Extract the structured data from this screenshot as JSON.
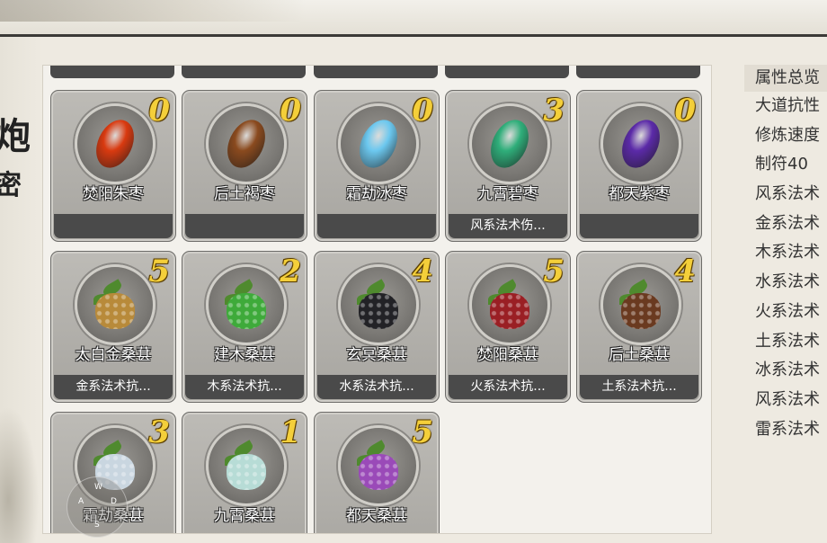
{
  "attributes": {
    "title": "属性总览",
    "rows": [
      "大道抗性",
      "修炼速度",
      "制符40",
      "风系法术",
      "金系法术",
      "木系法术",
      "水系法术",
      "火系法术",
      "土系法术",
      "冰系法术",
      "风系法术",
      "雷系法术"
    ]
  },
  "items": [
    {
      "name": "焚阳朱枣",
      "count": "0",
      "desc": "",
      "kind": "date",
      "color": "#d93a10"
    },
    {
      "name": "后土褐枣",
      "count": "0",
      "desc": "",
      "kind": "date",
      "color": "#8a4a1e"
    },
    {
      "name": "霜劫冰枣",
      "count": "0",
      "desc": "",
      "kind": "date",
      "color": "#6cc8ef"
    },
    {
      "name": "九霄碧枣",
      "count": "3",
      "desc": "风系法术伤...",
      "kind": "date",
      "color": "#2fae7a"
    },
    {
      "name": "都天紫枣",
      "count": "0",
      "desc": "",
      "kind": "date",
      "color": "#5b2aa8"
    },
    {
      "name": "太白金桑葚",
      "count": "5",
      "desc": "金系法术抗...",
      "kind": "berry",
      "color": "#b88a3a"
    },
    {
      "name": "建木桑葚",
      "count": "2",
      "desc": "木系法术抗...",
      "kind": "berry",
      "color": "#3eaa3a"
    },
    {
      "name": "玄冥桑葚",
      "count": "4",
      "desc": "水系法术抗...",
      "kind": "berry",
      "color": "#222226"
    },
    {
      "name": "焚阳桑葚",
      "count": "5",
      "desc": "火系法术抗...",
      "kind": "berry",
      "color": "#9a1f24"
    },
    {
      "name": "后土桑葚",
      "count": "4",
      "desc": "土系法术抗...",
      "kind": "berry",
      "color": "#6a3a20"
    },
    {
      "name": "霜劫桑葚",
      "count": "3",
      "desc": "",
      "kind": "berry",
      "color": "#c9d6e0"
    },
    {
      "name": "九霄桑葚",
      "count": "1",
      "desc": "",
      "kind": "berry",
      "color": "#b7dcd6"
    },
    {
      "name": "都天桑葚",
      "count": "5",
      "desc": "",
      "kind": "berry",
      "color": "#9a4ab8"
    }
  ],
  "side_glyphs": [
    "炮",
    "密"
  ],
  "joystick": {
    "a": "A",
    "d": "D",
    "w": "W",
    "s": "S"
  }
}
